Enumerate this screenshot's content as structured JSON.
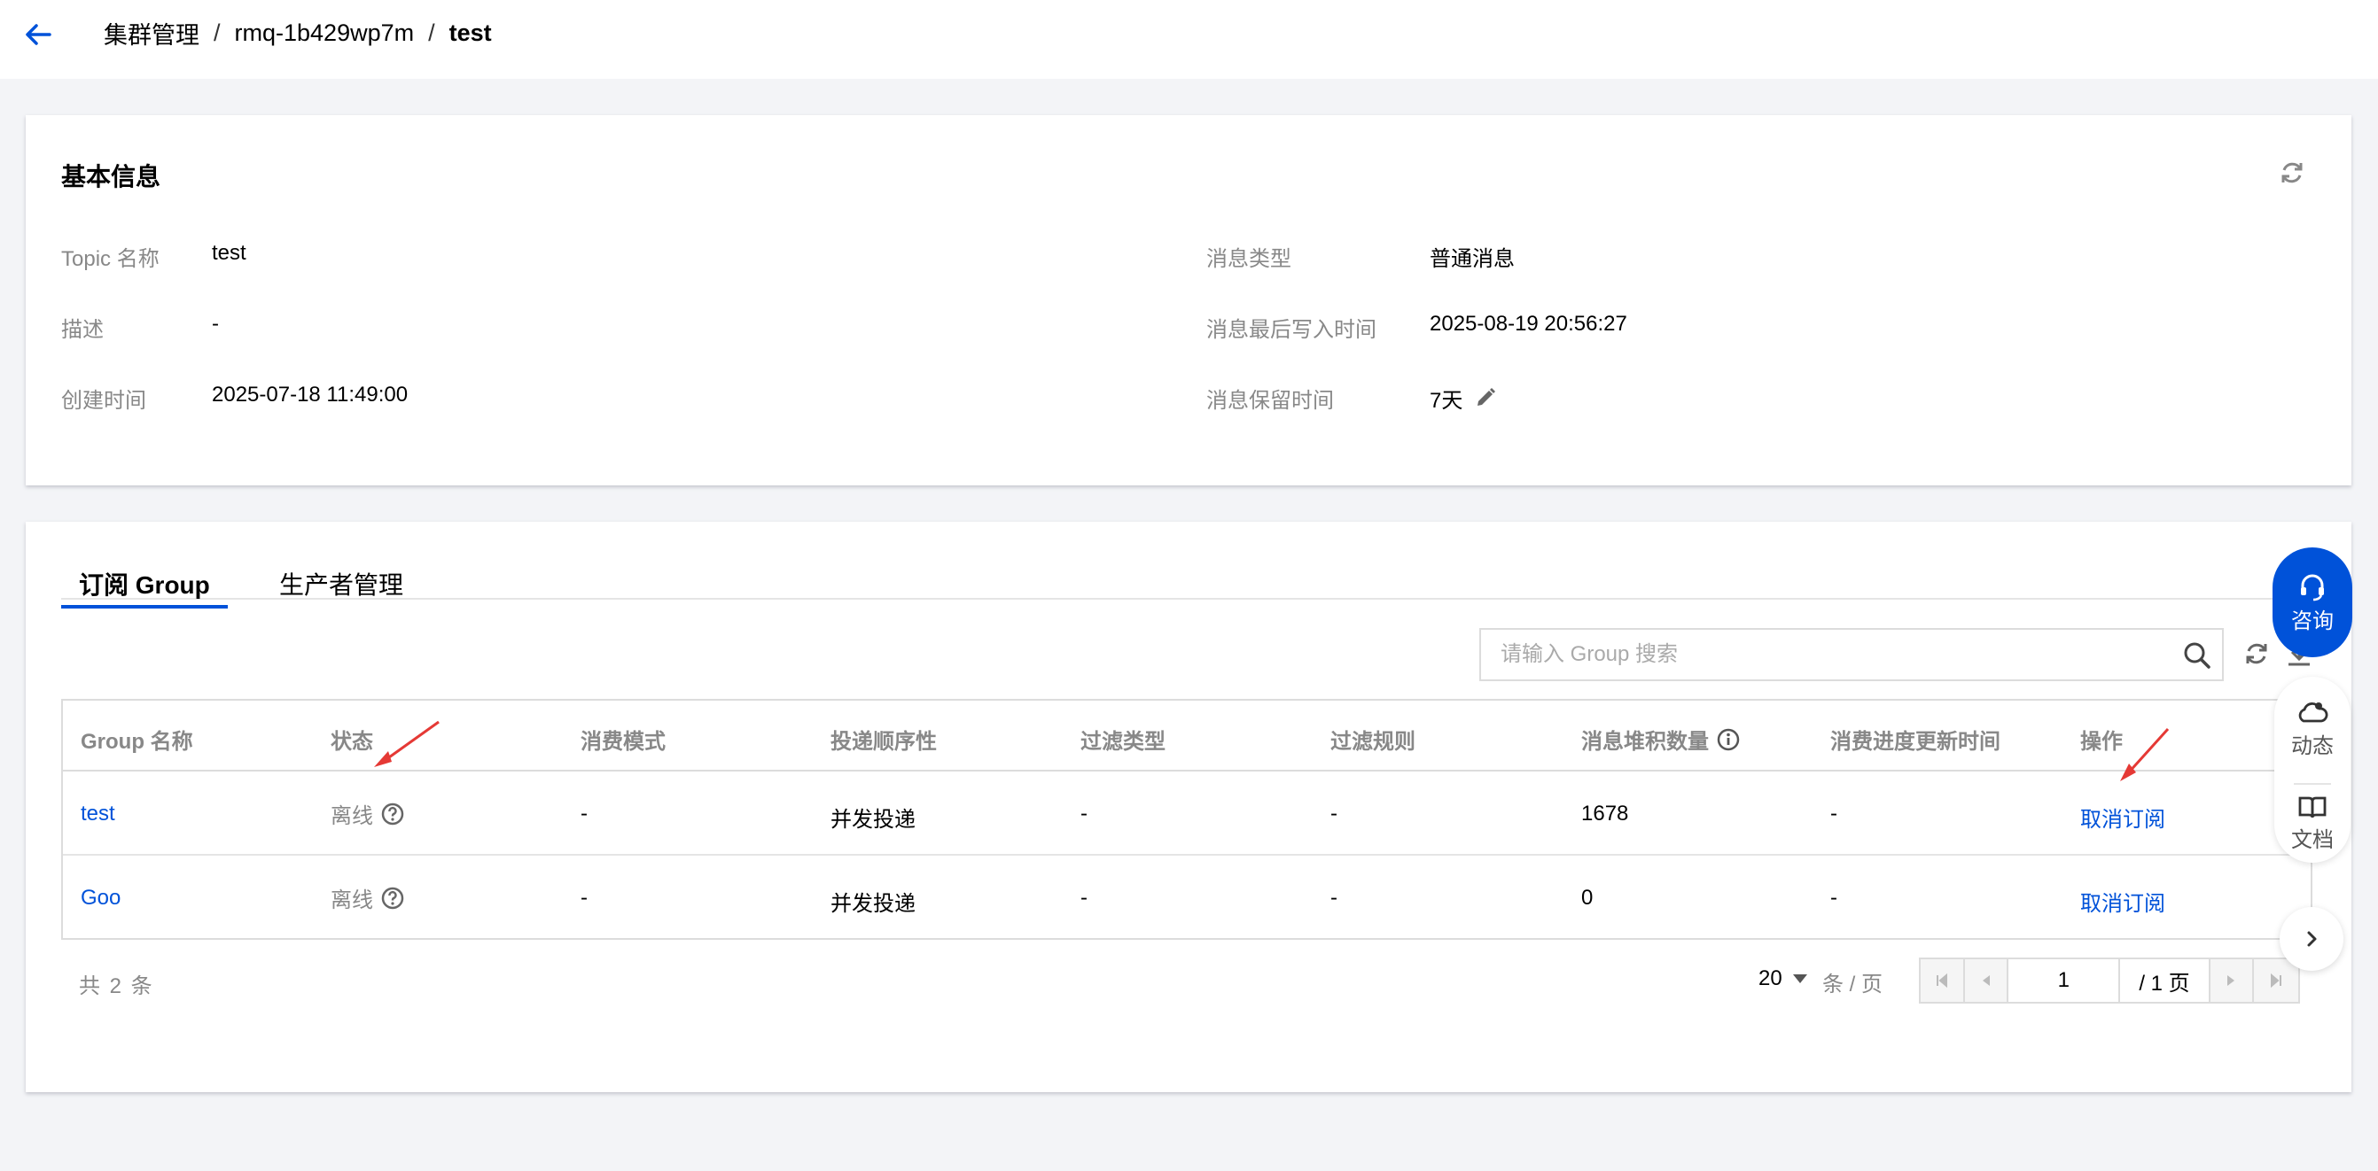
{
  "breadcrumb": {
    "items": [
      "集群管理",
      "rmq-1b429wp7m"
    ],
    "current": "test",
    "separator": "/"
  },
  "basic_info": {
    "title": "基本信息",
    "fields": [
      {
        "label": "Topic 名称",
        "value": "test"
      },
      {
        "label": "描述",
        "value": "-"
      },
      {
        "label": "创建时间",
        "value": "2025-07-18 11:49:00"
      },
      {
        "label": "消息类型",
        "value": "普通消息"
      },
      {
        "label": "消息最后写入时间",
        "value": "2025-08-19 20:56:27"
      },
      {
        "label": "消息保留时间",
        "value": "7天"
      }
    ]
  },
  "tabs": [
    {
      "label": "订阅 Group",
      "active": true
    },
    {
      "label": "生产者管理",
      "active": false
    }
  ],
  "search": {
    "placeholder": "请输入 Group 搜索",
    "value": ""
  },
  "table": {
    "columns": [
      "Group 名称",
      "状态",
      "消费模式",
      "投递顺序性",
      "过滤类型",
      "过滤规则",
      "消息堆积数量",
      "消费进度更新时间",
      "操作"
    ],
    "rows": [
      {
        "group": "test",
        "status": "离线",
        "mode": "-",
        "order": "并发投递",
        "filter_type": "-",
        "filter_rule": "-",
        "backlog": "1678",
        "updated": "-",
        "action": "取消订阅"
      },
      {
        "group": "Goo",
        "status": "离线",
        "mode": "-",
        "order": "并发投递",
        "filter_type": "-",
        "filter_rule": "-",
        "backlog": "0",
        "updated": "-",
        "action": "取消订阅"
      }
    ]
  },
  "pagination": {
    "total": "共 2 条",
    "page_size": "20",
    "per_page_label": "条 / 页",
    "current_page": "1",
    "total_pages": "/ 1 页"
  },
  "floating": {
    "consult": "咨询",
    "news": "动态",
    "docs": "文档"
  },
  "colors": {
    "primary": "#0052d9",
    "annotation_arrow": "#e53935",
    "muted": "#888888",
    "background": "#f3f4f7"
  }
}
